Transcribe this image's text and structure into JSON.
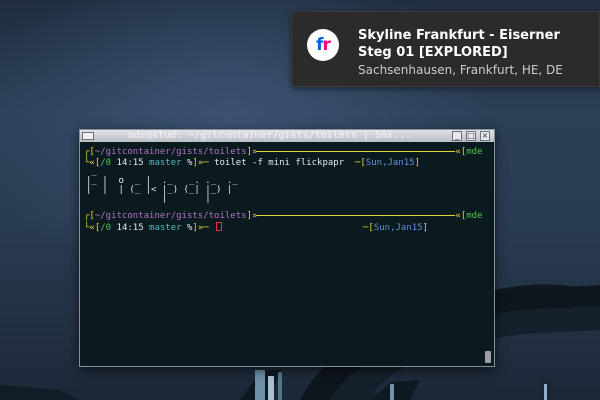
{
  "notification": {
    "app_icon": "flickr-icon",
    "icon_letters": {
      "f": "f",
      "r": "r"
    },
    "title": "Skyline Frankfurt - Eiserner Steg 01 [EXPLORED]",
    "body": "Sachsenhausen, Frankfurt, HE, DE",
    "colors": {
      "flickr_blue": "#0063dc",
      "flickr_pink": "#ff0084"
    }
  },
  "terminal": {
    "window_title": "mde@stud: ~/gitcontainer/gists/toilets | 56x...",
    "prompt1": {
      "open_bracket": "[",
      "path": "~/gitcontainer/gists/toilets",
      "close_bracket": "]",
      "user_host": "mde@stud",
      "status_open": "[",
      "status": "/0",
      "time": "14:15",
      "branch": "master",
      "dirty": "%",
      "cmd": "toilet -f mini flickpapr",
      "date": "Sun,Jan15"
    },
    "figlet_output": [
      " _      ",
      "|_ |  o  _ |  ._   _. ._  ._",
      "|  |  | (_ |< |_) (_| |_) |  ",
      "              |       |      "
    ],
    "prompt2": {
      "path": "~/gitcontainer/gists/toilets",
      "user_host": "mde@stud",
      "status": "/0",
      "time": "14:15",
      "branch": "master",
      "dirty": "%",
      "date": "Sun,Jan15"
    },
    "colors": {
      "background": "#0b1a1f",
      "frame": "#e6d33a",
      "path": "#b075c8",
      "host": "#4ec24e",
      "date": "#5f8fe0",
      "error": "#e03434"
    }
  }
}
